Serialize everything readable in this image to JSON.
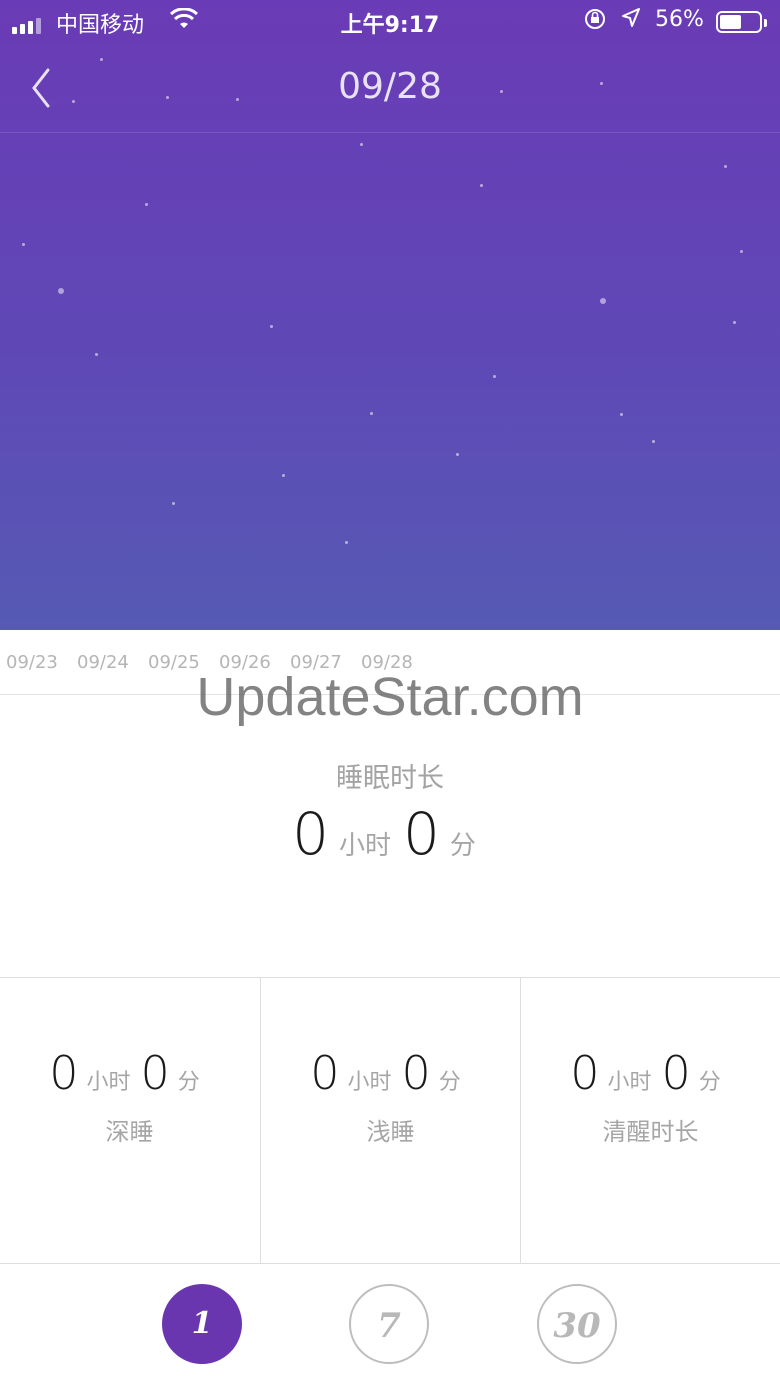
{
  "status_bar": {
    "carrier": "中国移动",
    "time": "上午9:17",
    "battery_percent": "56%",
    "battery_level": 0.56
  },
  "header": {
    "title": "09/28"
  },
  "date_axis": [
    "09/23",
    "09/24",
    "09/25",
    "09/26",
    "09/27",
    "09/28"
  ],
  "watermark": "UpdateStar.com",
  "summary": {
    "label": "睡眠时长",
    "hours": "0",
    "hours_unit": "小时",
    "minutes": "0",
    "minutes_unit": "分"
  },
  "stats": [
    {
      "hours": "0",
      "hours_unit": "小时",
      "minutes": "0",
      "minutes_unit": "分",
      "label": "深睡"
    },
    {
      "hours": "0",
      "hours_unit": "小时",
      "minutes": "0",
      "minutes_unit": "分",
      "label": "浅睡"
    },
    {
      "hours": "0",
      "hours_unit": "小时",
      "minutes": "0",
      "minutes_unit": "分",
      "label": "清醒时长"
    }
  ],
  "range_buttons": [
    {
      "label": "1",
      "active": true
    },
    {
      "label": "7",
      "active": false
    },
    {
      "label": "30",
      "active": false
    }
  ],
  "colors": {
    "hero_top": "#6a3bb6",
    "hero_bottom": "#565ab4",
    "accent": "#6a36b0"
  }
}
